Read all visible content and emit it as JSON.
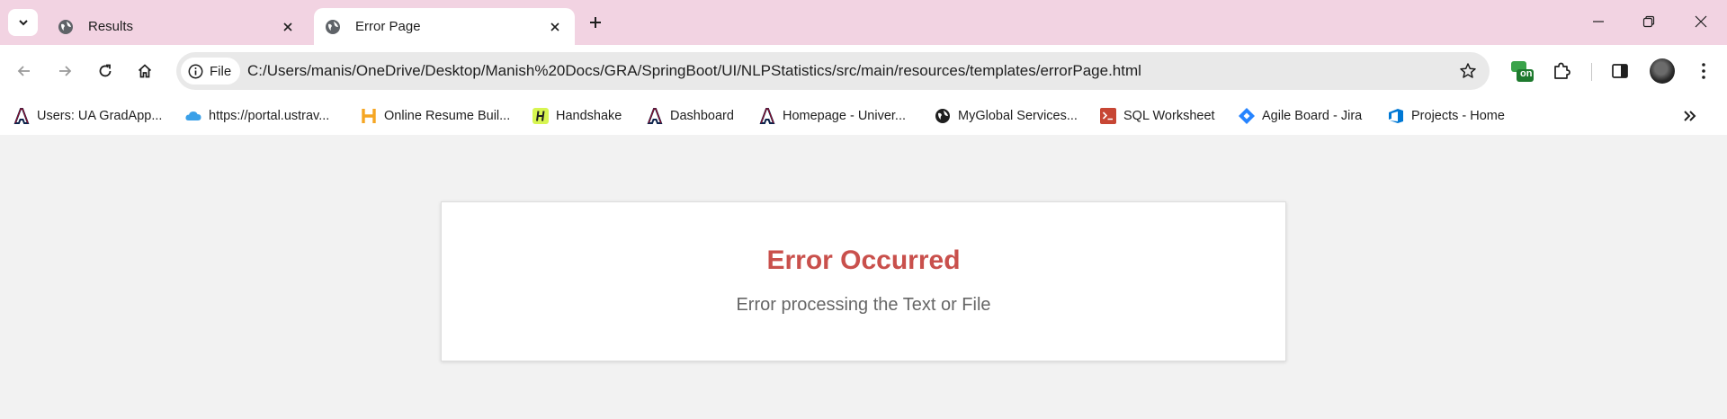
{
  "tabs": [
    {
      "title": "Results",
      "icon": "globe-icon",
      "active": false
    },
    {
      "title": "Error Page",
      "icon": "globe-icon",
      "active": true
    }
  ],
  "omnibox": {
    "chip_label": "File",
    "url": "C:/Users/manis/OneDrive/Desktop/Manish%20Docs/GRA/SpringBoot/UI/NLPStatistics/src/main/resources/templates/errorPage.html"
  },
  "extensions": {
    "badge_label": "on"
  },
  "bookmarks": [
    {
      "label": "Users: UA GradApp...",
      "icon": "arizona-a-icon"
    },
    {
      "label": "https://portal.ustrav...",
      "icon": "cloud-icon"
    },
    {
      "label": "Online Resume Buil...",
      "icon": "h-logo-icon"
    },
    {
      "label": "Handshake",
      "icon": "handshake-icon"
    },
    {
      "label": "Dashboard",
      "icon": "arizona-a-icon"
    },
    {
      "label": "Homepage - Univer...",
      "icon": "arizona-a-icon"
    },
    {
      "label": "MyGlobal Services...",
      "icon": "globe-icon"
    },
    {
      "label": "SQL Worksheet",
      "icon": "terminal-icon"
    },
    {
      "label": "Agile Board - Jira",
      "icon": "jira-icon"
    },
    {
      "label": "Projects - Home",
      "icon": "azure-devops-icon"
    }
  ],
  "page": {
    "heading": "Error Occurred",
    "message": "Error processing the Text or File"
  },
  "colors": {
    "tabstrip": "#f2d3e2",
    "heading": "#c9504c",
    "message": "#666666",
    "page_background": "#f2f2f2"
  }
}
